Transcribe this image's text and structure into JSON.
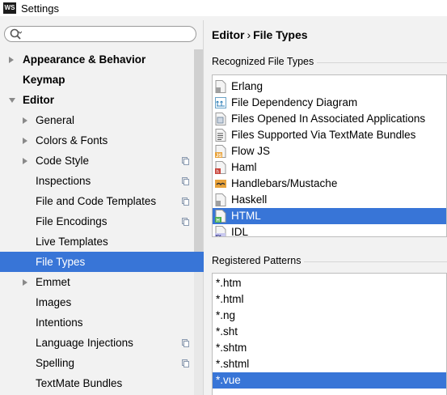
{
  "window": {
    "title": "Settings",
    "app_icon_text": "WS"
  },
  "search": {
    "placeholder": ""
  },
  "sidebar": {
    "items": [
      {
        "label": "Appearance & Behavior",
        "level": 0,
        "bold": true,
        "expander": "right"
      },
      {
        "label": "Keymap",
        "level": 0,
        "bold": true,
        "expander": "none"
      },
      {
        "label": "Editor",
        "level": 0,
        "bold": true,
        "expander": "down"
      },
      {
        "label": "General",
        "level": 1,
        "bold": false,
        "expander": "right"
      },
      {
        "label": "Colors & Fonts",
        "level": 1,
        "bold": false,
        "expander": "right"
      },
      {
        "label": "Code Style",
        "level": 1,
        "bold": false,
        "expander": "right",
        "copy_icon": true
      },
      {
        "label": "Inspections",
        "level": 1,
        "bold": false,
        "expander": "none",
        "copy_icon": true
      },
      {
        "label": "File and Code Templates",
        "level": 1,
        "bold": false,
        "expander": "none",
        "copy_icon": true
      },
      {
        "label": "File Encodings",
        "level": 1,
        "bold": false,
        "expander": "none",
        "copy_icon": true
      },
      {
        "label": "Live Templates",
        "level": 1,
        "bold": false,
        "expander": "none"
      },
      {
        "label": "File Types",
        "level": 1,
        "bold": false,
        "expander": "none",
        "selected": true
      },
      {
        "label": "Emmet",
        "level": 1,
        "bold": false,
        "expander": "right"
      },
      {
        "label": "Images",
        "level": 1,
        "bold": false,
        "expander": "none"
      },
      {
        "label": "Intentions",
        "level": 1,
        "bold": false,
        "expander": "none"
      },
      {
        "label": "Language Injections",
        "level": 1,
        "bold": false,
        "expander": "none",
        "copy_icon": true
      },
      {
        "label": "Spelling",
        "level": 1,
        "bold": false,
        "expander": "none",
        "copy_icon": true
      },
      {
        "label": "TextMate Bundles",
        "level": 1,
        "bold": false,
        "expander": "none"
      }
    ]
  },
  "main": {
    "breadcrumb": {
      "parent": "Editor",
      "separator": "›",
      "current": "File Types"
    },
    "recognized_label": "Recognized File Types",
    "registered_label": "Registered Patterns",
    "file_types": [
      {
        "label": "Erlang",
        "icon": "erlang-file-icon"
      },
      {
        "label": "File Dependency Diagram",
        "icon": "dependency-diagram-icon"
      },
      {
        "label": "Files Opened In Associated Applications",
        "icon": "associated-app-file-icon"
      },
      {
        "label": "Files Supported Via TextMate Bundles",
        "icon": "textmate-file-icon"
      },
      {
        "label": "Flow JS",
        "icon": "flow-js-file-icon"
      },
      {
        "label": "Haml",
        "icon": "haml-file-icon"
      },
      {
        "label": "Handlebars/Mustache",
        "icon": "handlebars-file-icon"
      },
      {
        "label": "Haskell",
        "icon": "haskell-file-icon"
      },
      {
        "label": "HTML",
        "icon": "html-file-icon",
        "selected": true
      },
      {
        "label": "IDL",
        "icon": "idl-file-icon"
      }
    ],
    "patterns": [
      {
        "label": "*.htm"
      },
      {
        "label": "*.html"
      },
      {
        "label": "*.ng"
      },
      {
        "label": "*.sht"
      },
      {
        "label": "*.shtm"
      },
      {
        "label": "*.shtml"
      },
      {
        "label": "*.vue",
        "selected": true
      }
    ]
  },
  "colors": {
    "selection": "#3875d7",
    "background": "#f2f2f2"
  }
}
